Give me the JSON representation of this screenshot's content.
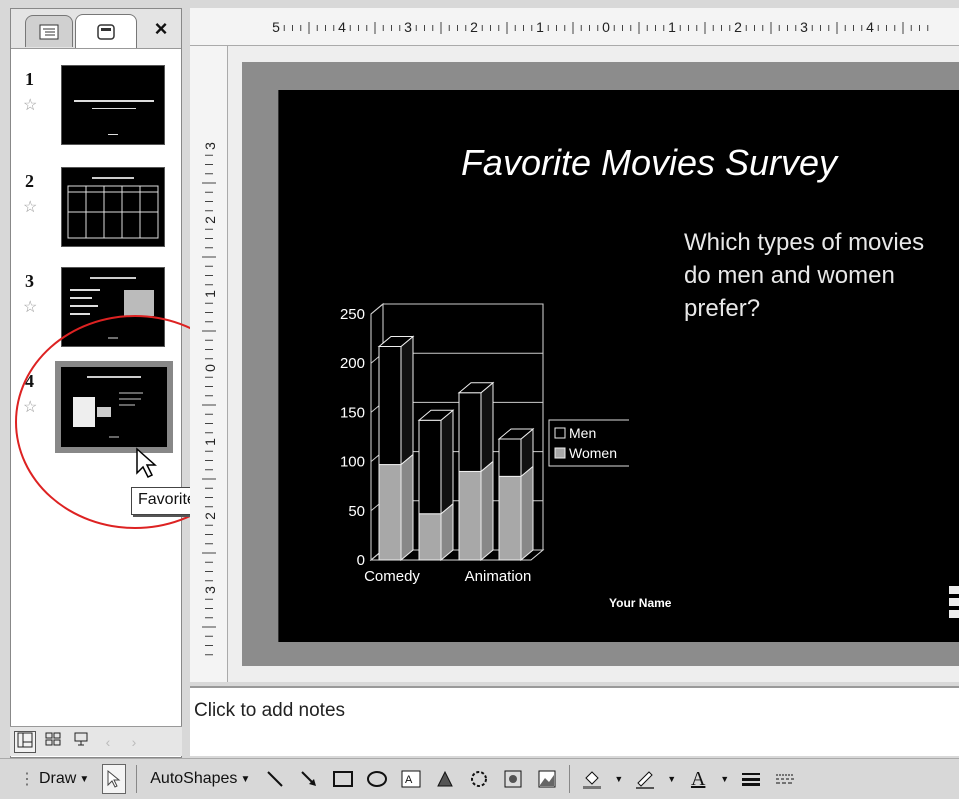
{
  "left_pane": {
    "tabs": [
      {
        "label": "Outline",
        "icon": "outline-tab-icon"
      },
      {
        "label": "Slides",
        "icon": "slides-tab-icon"
      }
    ],
    "close_glyph": "×",
    "thumbnails": [
      {
        "number": "1"
      },
      {
        "number": "2"
      },
      {
        "number": "3"
      },
      {
        "number": "4",
        "selected": true
      }
    ],
    "tooltip": "Favorite Movies Survey"
  },
  "ruler_top_labels": [
    "5",
    "4",
    "3",
    "2",
    "1",
    "0",
    "1",
    "2",
    "3",
    "4"
  ],
  "ruler_left_labels": [
    "3",
    "2",
    "1",
    "0",
    "1",
    "2",
    "3"
  ],
  "slide": {
    "title": "Favorite Movies Survey",
    "question": "Which types of movies do men and women prefer?",
    "footer": "Your Name",
    "background_color": "#000000"
  },
  "chart_data": {
    "type": "bar",
    "stacked": true,
    "three_d": true,
    "categories": [
      "Comedy",
      "",
      "Animation",
      ""
    ],
    "x_tick_labels": [
      "Comedy",
      "Animation"
    ],
    "series": [
      {
        "name": "Men",
        "values": [
          120,
          95,
          80,
          38
        ],
        "color": "#000000"
      },
      {
        "name": "Women",
        "values": [
          97,
          47,
          90,
          85
        ],
        "color": "#a8a8a8"
      }
    ],
    "ylim": [
      0,
      250
    ],
    "y_ticks": [
      "0",
      "50",
      "100",
      "150",
      "200",
      "250"
    ],
    "grid": true,
    "legend_position": "right"
  },
  "notes": {
    "placeholder": "Click to add notes"
  },
  "view_buttons": [
    "normal-view-icon",
    "slide-sorter-icon",
    "slide-show-icon"
  ],
  "toolbar": {
    "draw_label": "Draw",
    "autoshapes_label": "AutoShapes",
    "font_color_glyph": "A"
  }
}
